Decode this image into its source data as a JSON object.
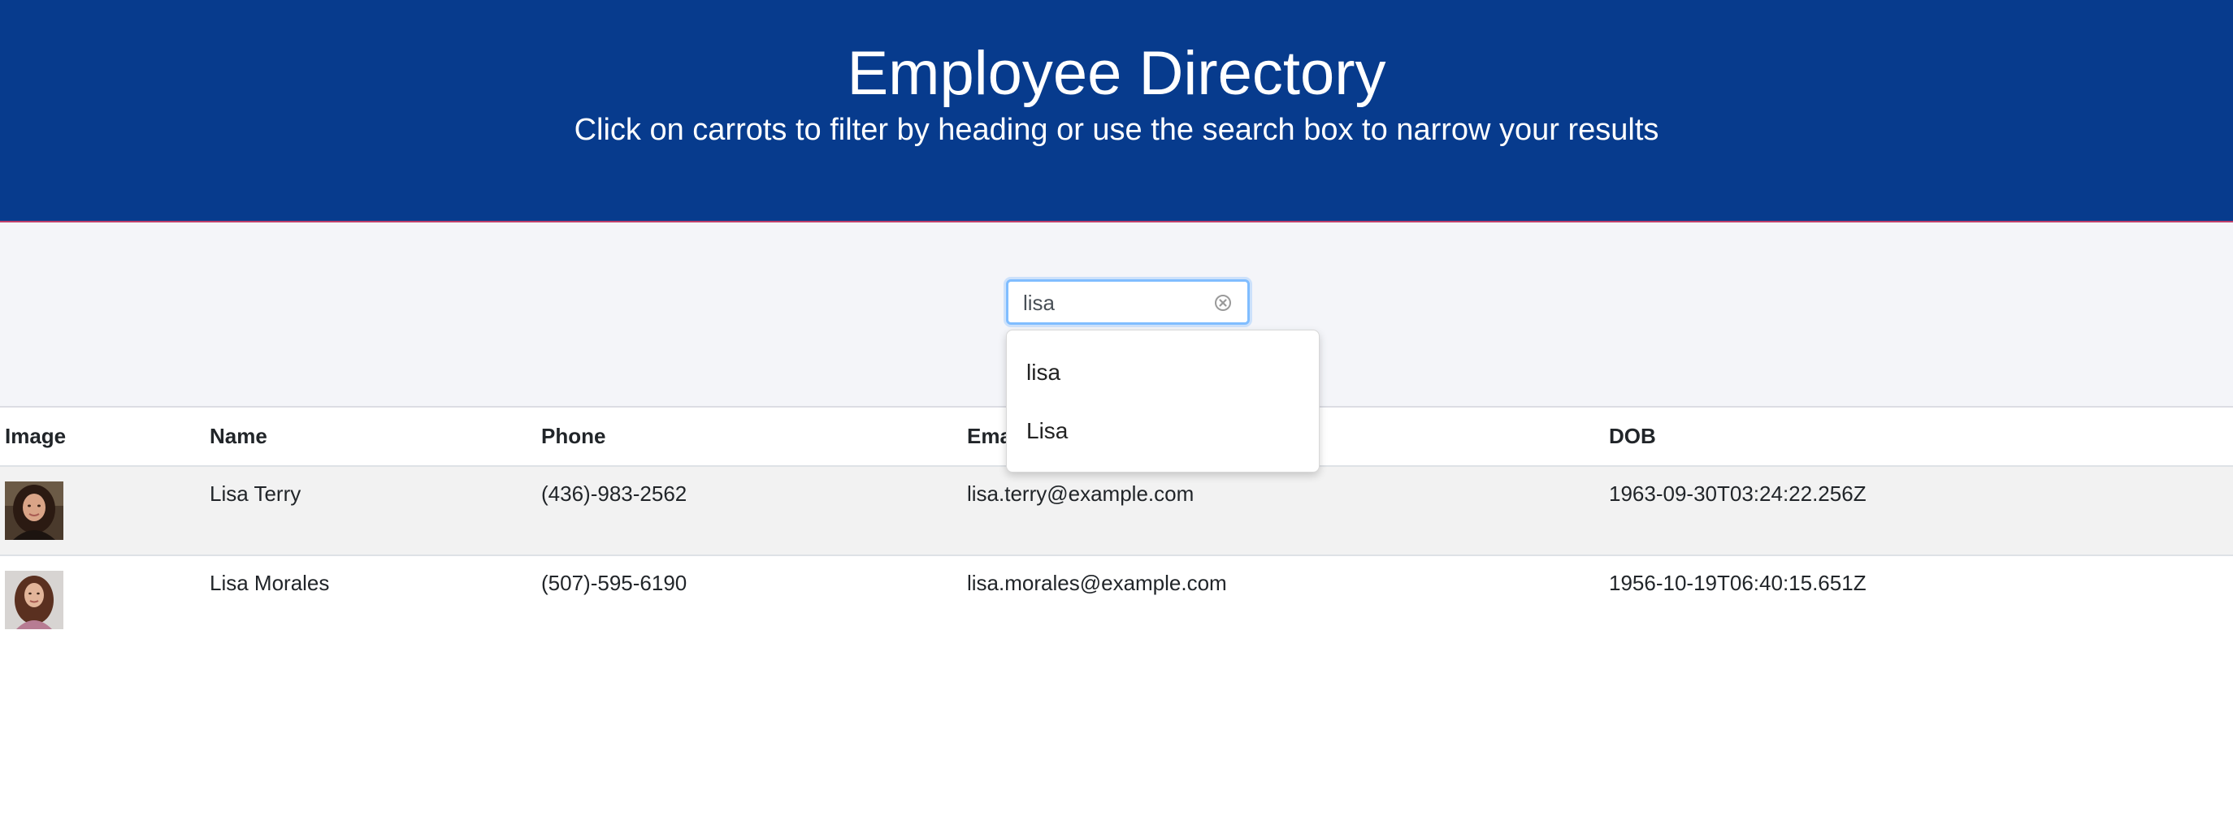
{
  "header": {
    "title": "Employee Directory",
    "subtitle": "Click on carrots to filter by heading or use the search box to narrow your results"
  },
  "search": {
    "value": "lisa",
    "suggestions": [
      "lisa",
      "Lisa"
    ]
  },
  "table": {
    "columns": [
      "Image",
      "Name",
      "Phone",
      "Email",
      "DOB"
    ],
    "rows": [
      {
        "name": "Lisa Terry",
        "phone": "(436)-983-2562",
        "email": "lisa.terry@example.com",
        "dob": "1963-09-30T03:24:22.256Z"
      },
      {
        "name": "Lisa Morales",
        "phone": "(507)-595-6190",
        "email": "lisa.morales@example.com",
        "dob": "1956-10-19T06:40:15.651Z"
      }
    ]
  },
  "colors": {
    "header_bg": "#073b8d",
    "header_border": "#c0406b",
    "search_band_bg": "#f4f5f9",
    "focus_ring": "#80bdff",
    "stripe": "#f2f2f2"
  }
}
